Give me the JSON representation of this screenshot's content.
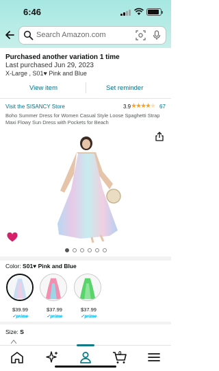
{
  "status_bar": {
    "time": "6:46"
  },
  "search": {
    "placeholder": "Search Amazon.com"
  },
  "purchase_notice": {
    "heading": "Purchased another variation 1 time",
    "date": "Last purchased Jun 29, 2023",
    "variation": "X-Large , S01♥ Pink and Blue",
    "view_item": "View item",
    "set_reminder": "Set reminder"
  },
  "product": {
    "store_link": "Visit the SISANCY Store",
    "rating": "3.9",
    "rating_stars": 3.9,
    "rating_count": "67",
    "title": "Boho Summer Dress for Women Casual Style Loose Spaghetti Strap Maxi Flowy Sun Dress with Pockets for Beach",
    "image_count": 6,
    "active_image": 1
  },
  "color": {
    "label": "Color: ",
    "selected": "S01♥ Pink and Blue",
    "options": [
      {
        "price": "$39.99",
        "prime": "✓prime",
        "icon": "dress-pink-blue",
        "selected": true
      },
      {
        "price": "$37.99",
        "prime": "✓prime",
        "icon": "dress-pink-multi",
        "selected": false
      },
      {
        "price": "$37.99",
        "prime": "✓prime",
        "icon": "dress-green",
        "selected": false
      }
    ]
  },
  "size": {
    "label": "Size: ",
    "selected": "S"
  },
  "bottom_nav": {
    "cart_count": "0",
    "items": [
      "home-icon",
      "sparkle-icon",
      "account-icon",
      "cart-icon",
      "menu-icon"
    ]
  },
  "colors": {
    "accent": "#007185",
    "nav_active": "#0e7b87",
    "prime": "#00a8e1",
    "star": "#ffa41c"
  }
}
